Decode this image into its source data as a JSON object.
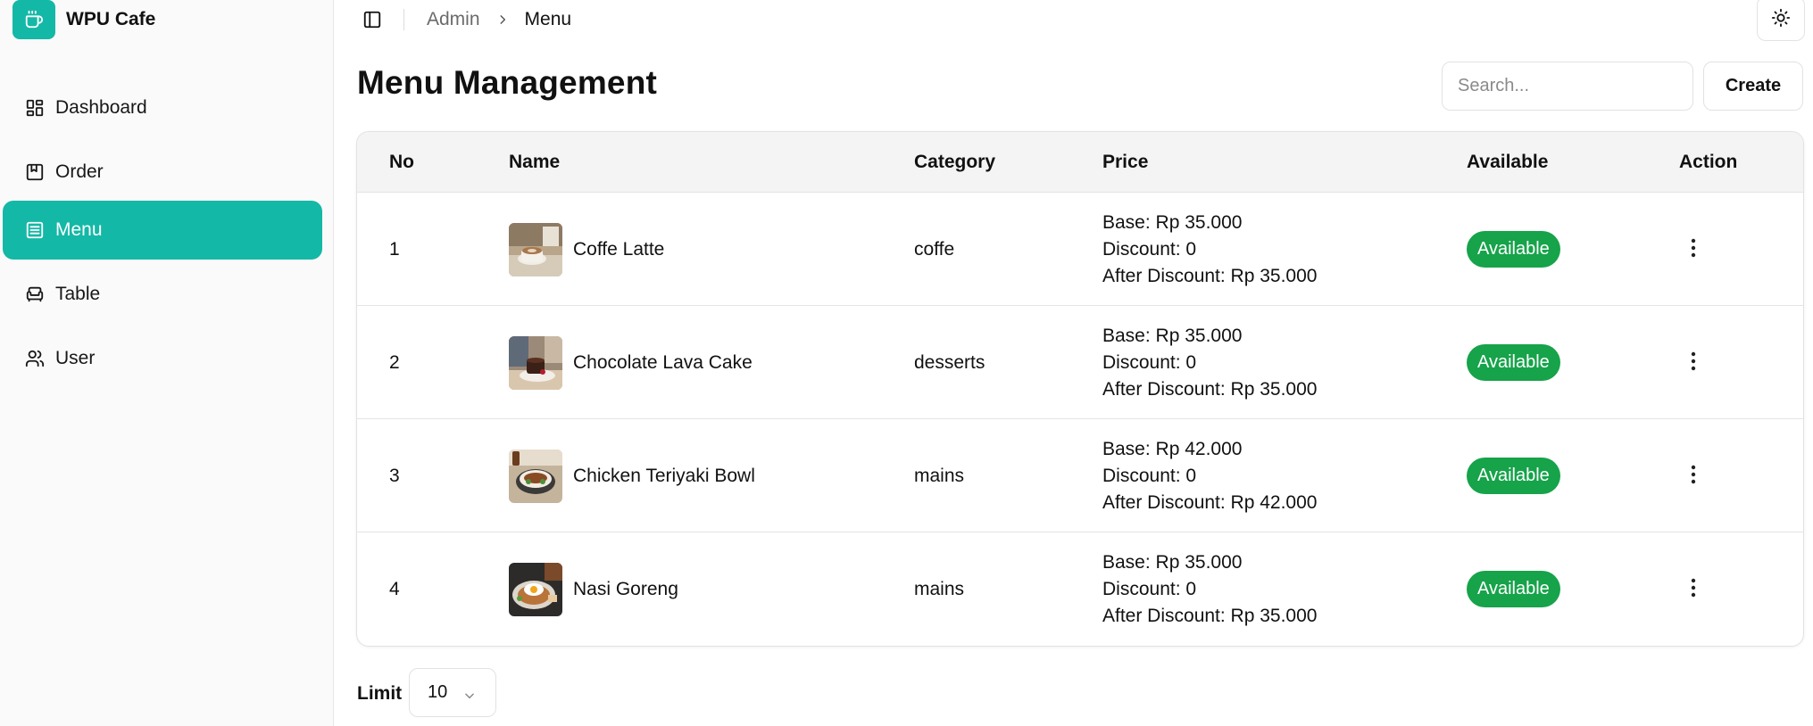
{
  "app": {
    "name": "WPU Cafe",
    "accent": "#14b8a6",
    "badge_color": "#16a34a"
  },
  "sidebar": {
    "items": [
      {
        "label": "Dashboard",
        "icon": "layout-dashboard-icon",
        "active": false
      },
      {
        "label": "Order",
        "icon": "bookmark-square-icon",
        "active": false
      },
      {
        "label": "Menu",
        "icon": "menu-list-icon",
        "active": true
      },
      {
        "label": "Table",
        "icon": "armchair-icon",
        "active": false
      },
      {
        "label": "User",
        "icon": "users-icon",
        "active": false
      }
    ]
  },
  "topbar": {
    "breadcrumb": [
      "Admin",
      "Menu"
    ],
    "toggle_icon": "sidebar-toggle-icon",
    "theme_icon": "sun-icon"
  },
  "page": {
    "title": "Menu Management",
    "search_placeholder": "Search...",
    "create_label": "Create"
  },
  "table": {
    "columns": [
      "No",
      "Name",
      "Category",
      "Price",
      "Available",
      "Action"
    ],
    "rows": [
      {
        "no": "1",
        "name": "Coffe Latte",
        "category": "coffe",
        "base": "Base: Rp 35.000",
        "discount": "Discount: 0",
        "after": "After Discount: Rp 35.000",
        "available": "Available"
      },
      {
        "no": "2",
        "name": "Chocolate Lava Cake",
        "category": "desserts",
        "base": "Base: Rp 35.000",
        "discount": "Discount: 0",
        "after": "After Discount: Rp 35.000",
        "available": "Available"
      },
      {
        "no": "3",
        "name": "Chicken Teriyaki Bowl",
        "category": "mains",
        "base": "Base: Rp 42.000",
        "discount": "Discount: 0",
        "after": "After Discount: Rp 42.000",
        "available": "Available"
      },
      {
        "no": "4",
        "name": "Nasi Goreng",
        "category": "mains",
        "base": "Base: Rp 35.000",
        "discount": "Discount: 0",
        "after": "After Discount: Rp 35.000",
        "available": "Available"
      }
    ]
  },
  "footer": {
    "limit_label": "Limit",
    "limit_value": "10"
  }
}
